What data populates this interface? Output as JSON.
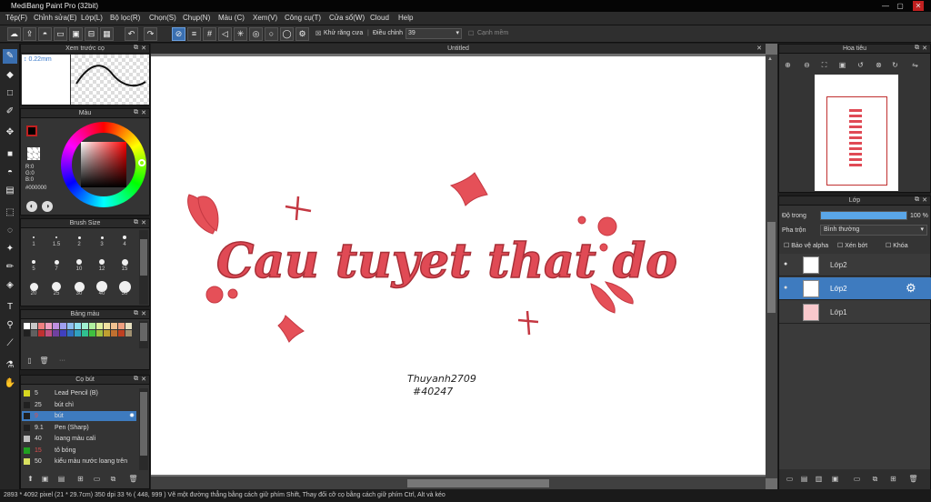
{
  "app": {
    "title": "MediBang Paint Pro (32bit)"
  },
  "menu": [
    "Tệp(F)",
    "Chỉnh sửa(E)",
    "Lớp(L)",
    "Bộ lọc(R)",
    "Chọn(S)",
    "Chụp(N)",
    "Màu (C)",
    "Xem(V)",
    "Công cụ(T)",
    "Cửa sổ(W)",
    "Cloud",
    "Help"
  ],
  "toolbar": {
    "antialias_label": "Khử răng cưa",
    "correction_label": "Điều chỉnh",
    "correction_value": "39",
    "snap_label": "Cạnh mềm"
  },
  "brush_preview": {
    "title": "Xem trước cọ",
    "size": "0.22mm"
  },
  "color": {
    "title": "Màu",
    "r": "R:0",
    "g": "G:0",
    "b": "B:0",
    "hex": "#000000"
  },
  "brush_size": {
    "title": "Brush Size",
    "sizes": [
      "1",
      "1.5",
      "2",
      "3",
      "4",
      "5",
      "7",
      "10",
      "12",
      "15",
      "20",
      "25",
      "30",
      "40",
      "50"
    ]
  },
  "palette": {
    "title": "Bảng màu",
    "more": "···",
    "colors": [
      "#ffffff",
      "#c8c8c8",
      "#f08080",
      "#f0a0c0",
      "#c090e0",
      "#a0a0f0",
      "#90c0f0",
      "#90e0f0",
      "#a0f0d0",
      "#b0f0a0",
      "#e0f0a0",
      "#f0e0a0",
      "#f0c090",
      "#f0a080",
      "#e8e0c0",
      "#202020",
      "#606060",
      "#c03030",
      "#c05080",
      "#7040a0",
      "#4040c0",
      "#3070c0",
      "#30a0c0",
      "#30c090",
      "#40c040",
      "#a0c040",
      "#c0a030",
      "#c07030",
      "#c04020",
      "#a09070"
    ]
  },
  "brush_list": {
    "title": "Cọ bút",
    "items": [
      {
        "size": "5",
        "name": "Lead Pencil (B)",
        "color": "#d8d820"
      },
      {
        "size": "25",
        "name": "bút chì",
        "color": "#202020"
      },
      {
        "size": "9",
        "name": "bút",
        "color": "#202020"
      },
      {
        "size": "9.1",
        "name": "Pen (Sharp)",
        "color": "#202020"
      },
      {
        "size": "40",
        "name": "loang màu cali",
        "color": "#c0c0c0"
      },
      {
        "size": "15",
        "name": "tô bóng",
        "color": "#20a020"
      },
      {
        "size": "50",
        "name": "kiểu màu nước loang trên",
        "color": "#d8e060"
      }
    ]
  },
  "document": {
    "tab": "Untitled",
    "art_text": "Cau tuyet that do",
    "signature_line1": "Thuyanh2709",
    "signature_line2": "#40247"
  },
  "navigator": {
    "title": "Hoa tiêu"
  },
  "layers": {
    "title": "Lớp",
    "opacity_label": "Độ trong",
    "opacity_value": "100 %",
    "opacity_level": 1.0,
    "blend_label": "Pha trộn",
    "blend_value": "Bình thường",
    "protect_alpha": "Bảo vệ alpha",
    "clipping": "Xén bớt",
    "lock": "Khóa",
    "items": [
      {
        "name": "Lớp2",
        "selected": false
      },
      {
        "name": "Lớp2",
        "selected": true
      },
      {
        "name": "Lớp1",
        "selected": false
      }
    ]
  },
  "status": {
    "text": "2893 * 4092 pixel    (21 * 29.7cm)   350 dpi   33 %    ( 448, 999 )   Vẽ một đường thẳng bằng cách giữ phím Shift, Thay đổi cỡ cọ bằng cách giữ phím Ctrl, Alt và kéo"
  }
}
